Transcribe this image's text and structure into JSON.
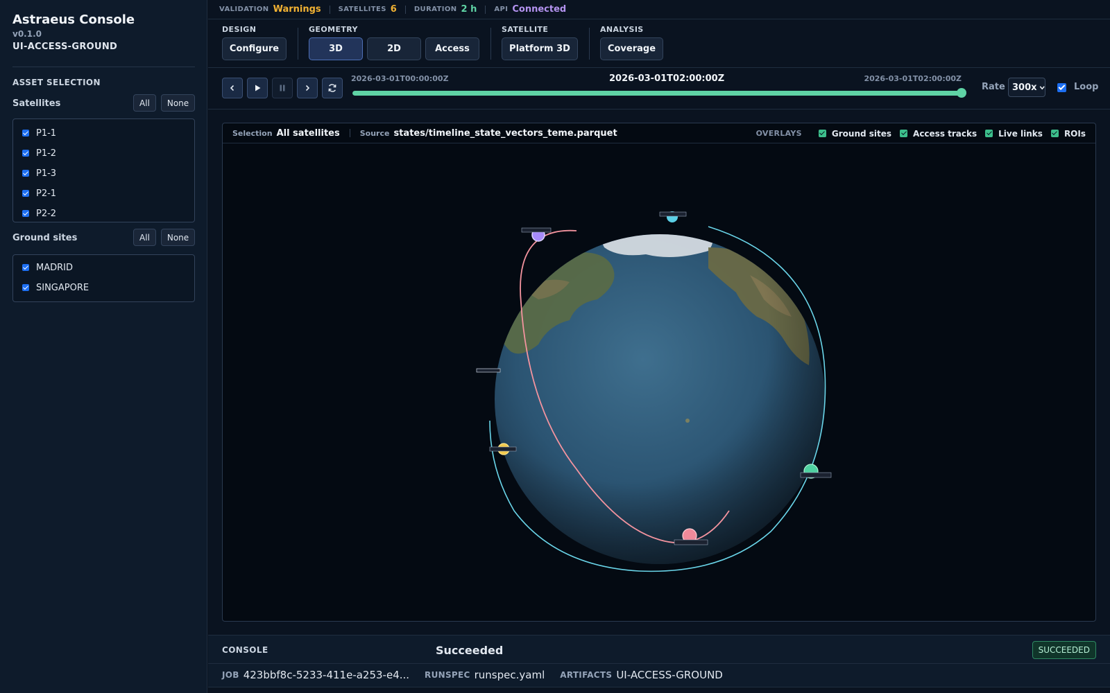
{
  "app": {
    "title": "Astraeus Console",
    "version": "v0.1.0",
    "scenario": "UI-ACCESS-GROUND"
  },
  "sidebar": {
    "section_title": "ASSET SELECTION",
    "satellites": {
      "title": "Satellites",
      "all_label": "All",
      "none_label": "None",
      "items": [
        {
          "label": "P1-1",
          "checked": true
        },
        {
          "label": "P1-2",
          "checked": true
        },
        {
          "label": "P1-3",
          "checked": true
        },
        {
          "label": "P2-1",
          "checked": true
        },
        {
          "label": "P2-2",
          "checked": true
        }
      ]
    },
    "ground_sites": {
      "title": "Ground sites",
      "all_label": "All",
      "none_label": "None",
      "items": [
        {
          "label": "MADRID",
          "checked": true
        },
        {
          "label": "SINGAPORE",
          "checked": true
        }
      ]
    }
  },
  "status": {
    "validation_label": "VALIDATION",
    "validation_value": "Warnings",
    "satellites_label": "SATELLITES",
    "satellites_value": "6",
    "duration_label": "DURATION",
    "duration_value": "2 h",
    "api_label": "API",
    "api_value": "Connected",
    "colors": {
      "warnings": "#f2b233",
      "satellites": "#f2b233",
      "duration": "#5fd3a5",
      "api": "#b493f0"
    }
  },
  "toolbar": {
    "design": {
      "label": "DESIGN",
      "buttons": [
        "Configure"
      ]
    },
    "geometry": {
      "label": "GEOMETRY",
      "buttons": [
        "3D",
        "2D",
        "Access"
      ],
      "active": "3D"
    },
    "satellite": {
      "label": "SATELLITE",
      "buttons": [
        "Platform 3D"
      ]
    },
    "analysis": {
      "label": "ANALYSIS",
      "buttons": [
        "Coverage"
      ]
    }
  },
  "timeline": {
    "start": "2026-03-01T00:00:00Z",
    "current": "2026-03-01T02:00:00Z",
    "end": "2026-03-01T02:00:00Z",
    "progress": 1.0,
    "rate_label": "Rate",
    "rate_value": "300x",
    "loop_label": "Loop",
    "loop_checked": true,
    "controls": [
      "chevron-left-icon",
      "play-icon",
      "pause-icon",
      "chevron-right-icon",
      "refresh-icon"
    ]
  },
  "viewport": {
    "selection_label": "Selection",
    "selection_value": "All satellites",
    "source_label": "Source",
    "source_value": "states/timeline_state_vectors_teme.parquet",
    "overlays_title": "OVERLAYS",
    "overlays": [
      {
        "label": "Ground sites",
        "checked": true
      },
      {
        "label": "Access tracks",
        "checked": true
      },
      {
        "label": "Live links",
        "checked": true
      },
      {
        "label": "ROIs",
        "checked": true
      }
    ],
    "satellite_colors": {
      "purple": "#a78bfa",
      "cyan": "#5bd0e6",
      "yellow": "#f2c94c",
      "green": "#4fd1a0",
      "pink": "#f08a9a"
    }
  },
  "console": {
    "title": "CONSOLE",
    "status_text": "Succeeded",
    "badge": "SUCCEEDED",
    "job_label": "JOB",
    "job_value": "423bbf8c-5233-411e-a253-e4...",
    "runspec_label": "RUNSPEC",
    "runspec_value": "runspec.yaml",
    "artifacts_label": "ARTIFACTS",
    "artifacts_value": "UI-ACCESS-GROUND"
  }
}
